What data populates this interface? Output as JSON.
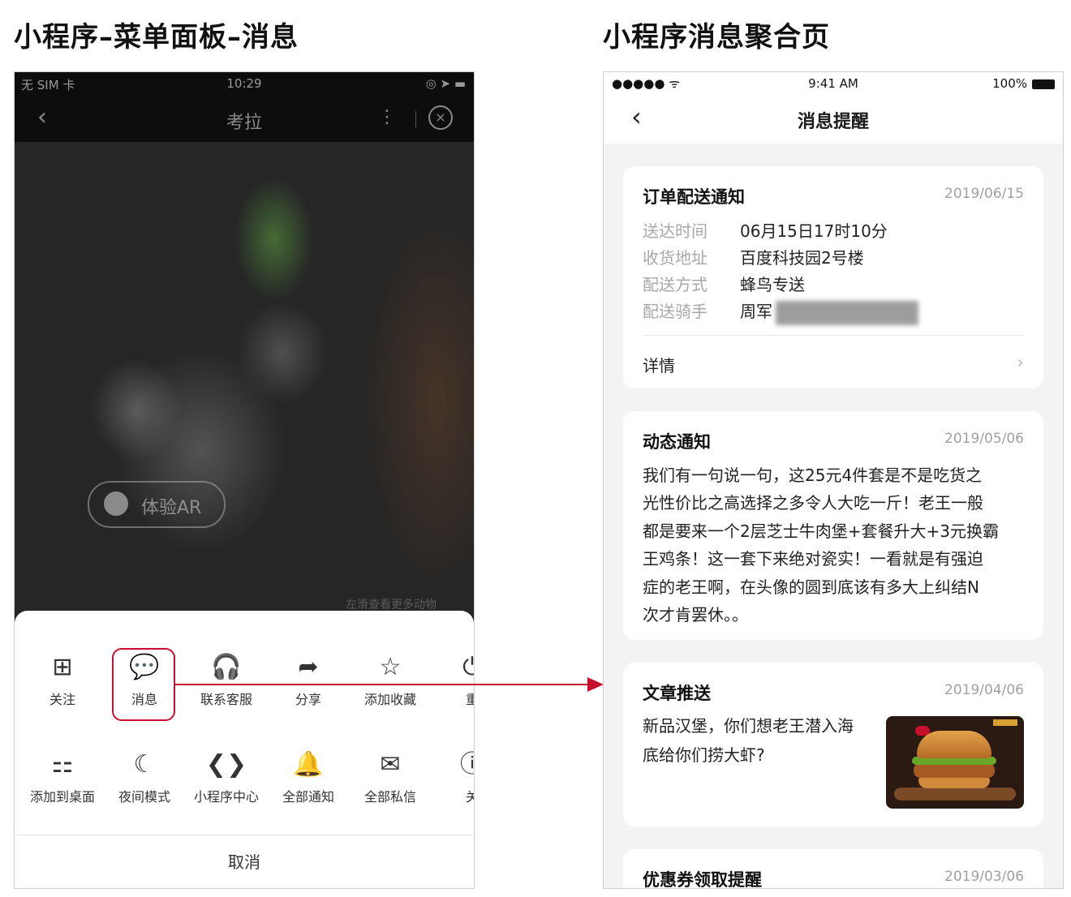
{
  "headings": {
    "left": "小程序–菜单面板–消息",
    "right": "小程序消息聚合页"
  },
  "left_phone": {
    "status": {
      "carrier": "无 SIM 卡",
      "time": "10:29",
      "right_icons": "◎ ➤ ▬"
    },
    "nav": {
      "back": "‹",
      "title": "考拉",
      "more": "⋮",
      "close": "×"
    },
    "photo": {
      "ar_button": "体验AR",
      "hint": "左滑查看更多动物"
    },
    "menu_row1": [
      {
        "label": "关注",
        "icon": "plus-square-icon",
        "glyph": "⊞"
      },
      {
        "label": "消息",
        "icon": "chat-bubble-icon",
        "glyph": "💬"
      },
      {
        "label": "联系客服",
        "icon": "headset-icon",
        "glyph": "🎧"
      },
      {
        "label": "分享",
        "icon": "share-arrow-icon",
        "glyph": "➦"
      },
      {
        "label": "添加收藏",
        "icon": "star-icon",
        "glyph": "☆"
      },
      {
        "label": "重",
        "icon": "restart-icon",
        "glyph": "⏻"
      }
    ],
    "menu_row2": [
      {
        "label": "添加到桌面",
        "icon": "add-to-desktop-icon",
        "glyph": "⚏"
      },
      {
        "label": "夜间模式",
        "icon": "moon-icon",
        "glyph": "☾"
      },
      {
        "label": "小程序中心",
        "icon": "mini-program-center-icon",
        "glyph": "❮❯"
      },
      {
        "label": "全部通知",
        "icon": "bell-icon",
        "glyph": "🔔"
      },
      {
        "label": "全部私信",
        "icon": "envelope-icon",
        "glyph": "✉"
      },
      {
        "label": "关",
        "icon": "info-icon",
        "glyph": "ⓘ"
      }
    ],
    "cancel": "取消"
  },
  "right_phone": {
    "status": {
      "signal": "●●●●● ᯤ",
      "time": "9:41 AM",
      "battery": "100%"
    },
    "nav": {
      "back": "‹",
      "title": "消息提醒"
    },
    "card1": {
      "title": "订单配送通知",
      "date": "2019/06/15",
      "rows": [
        {
          "key": "送达时间",
          "value": "06月15日17时10分"
        },
        {
          "key": "收货地址",
          "value": "百度科技园2号楼"
        },
        {
          "key": "配送方式",
          "value": "蜂鸟专送"
        },
        {
          "key": "配送骑手",
          "value": "周军"
        }
      ],
      "detail": "详情",
      "chevron": "›"
    },
    "card2": {
      "title": "动态通知",
      "date": "2019/05/06",
      "lines": [
        "我们有一句说一句，这25元4件套是不是吃货之",
        "光性价比之高选择之多令人大吃一斤！老王一般",
        "都是要来一个2层芝士牛肉堡+套餐升大+3元换霸",
        "王鸡条！这一套下来绝对瓷实！一看就是有强迫",
        "症的老王啊，在头像的圆到底该有多大上纠结N",
        "次才肯罢休。。"
      ]
    },
    "card3": {
      "title": "文章推送",
      "date": "2019/04/06",
      "lines": [
        "新品汉堡，你们想老王潜入海",
        "底给你们捞大虾?"
      ]
    },
    "card4": {
      "title": "优惠券领取提醒",
      "date": "2019/03/06"
    }
  },
  "colors": {
    "highlight": "#c8102e"
  }
}
